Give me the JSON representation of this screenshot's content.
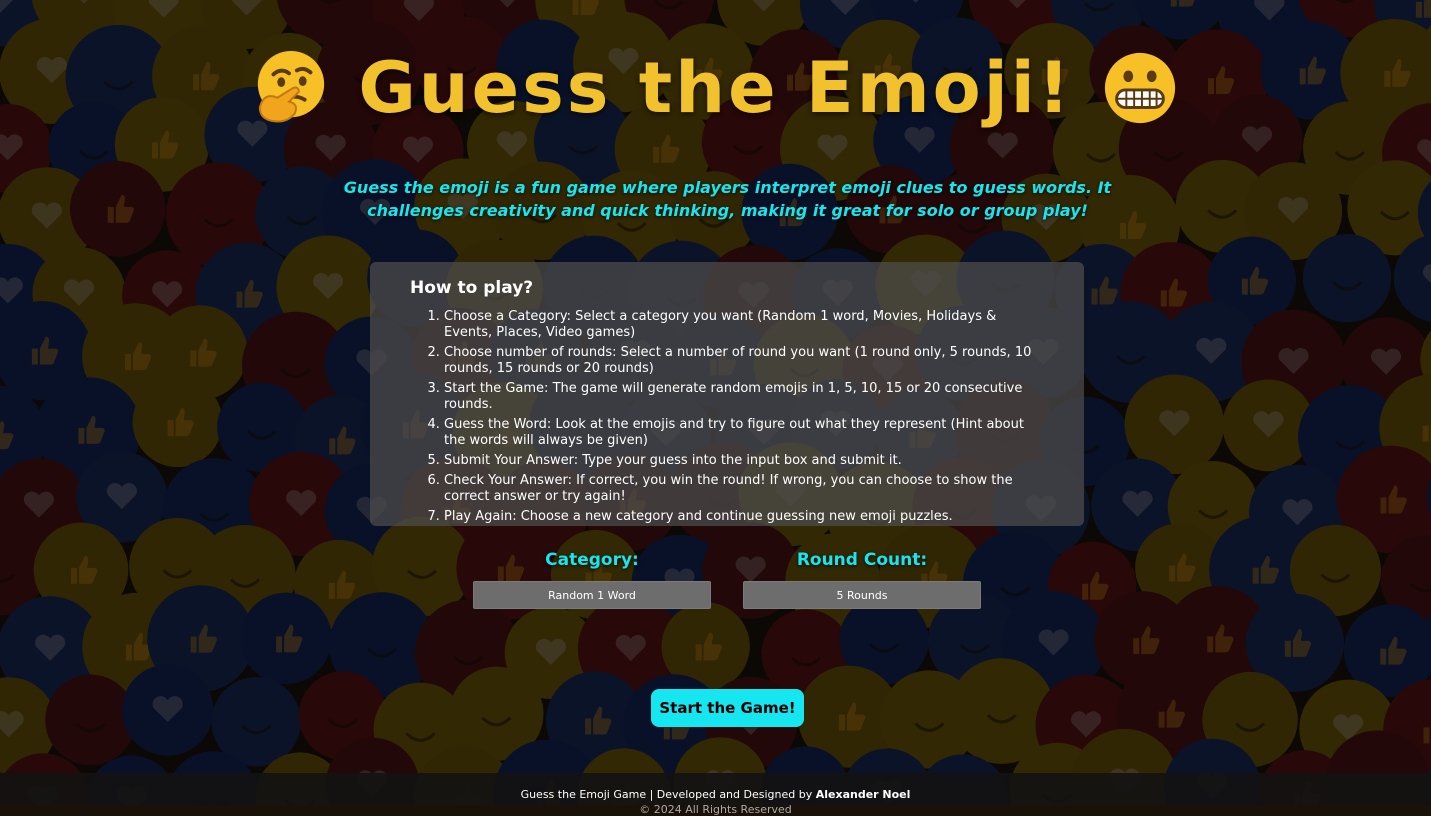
{
  "header": {
    "title": "Guess the Emoji!",
    "left_emoji": "thinking-face",
    "right_emoji": "grimacing-face"
  },
  "tagline": "Guess the emoji is a fun game where players interpret emoji clues to guess words. It challenges creativity and quick thinking, making it great for solo or group play!",
  "how_to": {
    "heading": "How to play?",
    "steps": [
      "Choose a Category: Select a category you want (Random 1 word, Movies, Holidays & Events, Places, Video games)",
      "Choose number of rounds: Select a number of round you want (1 round only, 5 rounds, 10 rounds, 15 rounds or 20 rounds)",
      "Start the Game: The game will generate random emojis in 1, 5, 10, 15 or 20 consecutive rounds.",
      "Guess the Word: Look at the emojis and try to figure out what they represent (Hint about the words will always be given)",
      "Submit Your Answer: Type your guess into the input box and submit it.",
      "Check Your Answer: If correct, you win the round! If wrong, you can choose to show the correct answer or try again!",
      "Play Again: Choose a new category and continue guessing new emoji puzzles."
    ]
  },
  "controls": {
    "category_label": "Category:",
    "category_value": "Random 1 Word",
    "rounds_label": "Round Count:",
    "rounds_value": "5 Rounds",
    "start_label": "Start the Game!"
  },
  "footer": {
    "line1_prefix": "Guess the Emoji Game | Developed and Designed by ",
    "author": "Alexander Noel",
    "line2": "© 2024 All Rights Reserved"
  },
  "colors": {
    "title": "#f2c12e",
    "accent": "#16e6f0",
    "panel": "#4e4e4e",
    "select": "#6d6d6d"
  }
}
